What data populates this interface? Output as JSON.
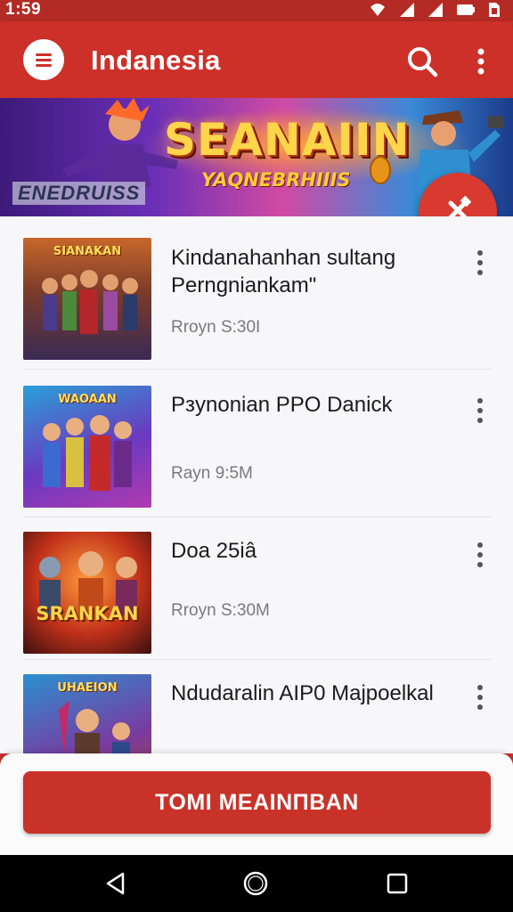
{
  "status_bar": {
    "time": "1:59"
  },
  "app_bar": {
    "title": "Indanesia"
  },
  "banner": {
    "title": "SEANAIIN",
    "subtitle": "YAQNEBRHIIIS",
    "logo_text": "ENEDRUISS"
  },
  "list": {
    "items": [
      {
        "title": "Kindanahanhan sultang Perngniankam\"",
        "meta": "Rroyn S:30I",
        "thumb_label": "SIANAKAN"
      },
      {
        "title": "Pзynonian PPO Danick",
        "meta": "Rayn 9:5M",
        "thumb_label": "WAOAAN"
      },
      {
        "title": "Doa 25iâ",
        "meta": "Rroyn S:30M",
        "thumb_label": "SRANKAN"
      },
      {
        "title": "Ndudaralin AIP0 Majpoelkal",
        "meta": "",
        "thumb_label": "UHAEION"
      }
    ]
  },
  "cta": {
    "label": "TOMI MEAINΠBAN"
  },
  "colors": {
    "primary": "#cc3029",
    "accent": "#d83a30",
    "list_bg": "#f7f7fa"
  }
}
